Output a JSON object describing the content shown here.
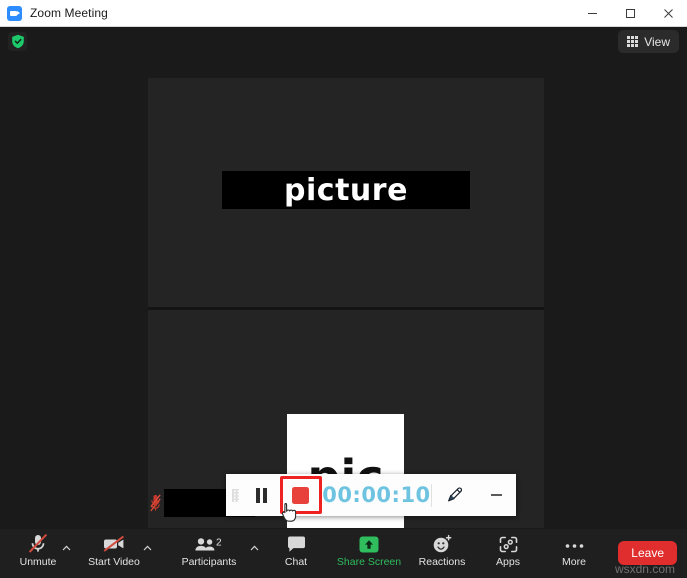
{
  "window": {
    "title": "Zoom Meeting",
    "app_icon": "zoom-logo-icon",
    "controls": {
      "minimize": "minimize-icon",
      "maximize": "maximize-icon",
      "close": "close-icon"
    }
  },
  "header": {
    "security_icon": "shield-check-icon",
    "view_button": {
      "label": "View",
      "icon": "grid-icon"
    }
  },
  "stage": {
    "shared_title": "picture",
    "shared_doc_text": "pic",
    "participant_top": {
      "mic_icon": "mic-off-icon",
      "name": ""
    },
    "participant_bottom": {
      "mic_icon": "mic-off-icon",
      "name": ""
    }
  },
  "recorder": {
    "grip_icon": "drag-handle-icon",
    "pause_icon": "pause-icon",
    "stop_icon": "stop-recording-icon",
    "timer": "00:00:10",
    "pen_icon": "pen-annotate-icon",
    "minimize_icon": "minimize-icon",
    "highlight_color": "#ee2222",
    "timer_color": "#6ec4e0"
  },
  "toolbar": {
    "items": [
      {
        "label": "Unmute",
        "icon": "mic-off-icon",
        "has_caret": true,
        "accent": false
      },
      {
        "label": "Start Video",
        "icon": "video-off-icon",
        "has_caret": true,
        "accent": false
      },
      {
        "label": "Participants",
        "icon": "participants-icon",
        "has_caret": true,
        "accent": false,
        "badge": "2"
      },
      {
        "label": "Chat",
        "icon": "chat-icon",
        "has_caret": false,
        "accent": false
      },
      {
        "label": "Share Screen",
        "icon": "share-screen-icon",
        "has_caret": false,
        "accent": true
      },
      {
        "label": "Reactions",
        "icon": "reactions-icon",
        "has_caret": false,
        "accent": false
      },
      {
        "label": "Apps",
        "icon": "apps-icon",
        "has_caret": false,
        "accent": false
      },
      {
        "label": "More",
        "icon": "more-icon",
        "has_caret": false,
        "accent": false
      }
    ],
    "leave_label": "Leave",
    "leave_color": "#e02d2d",
    "share_accent_color": "#2fbd5d"
  },
  "watermark": "wsxdn.com"
}
